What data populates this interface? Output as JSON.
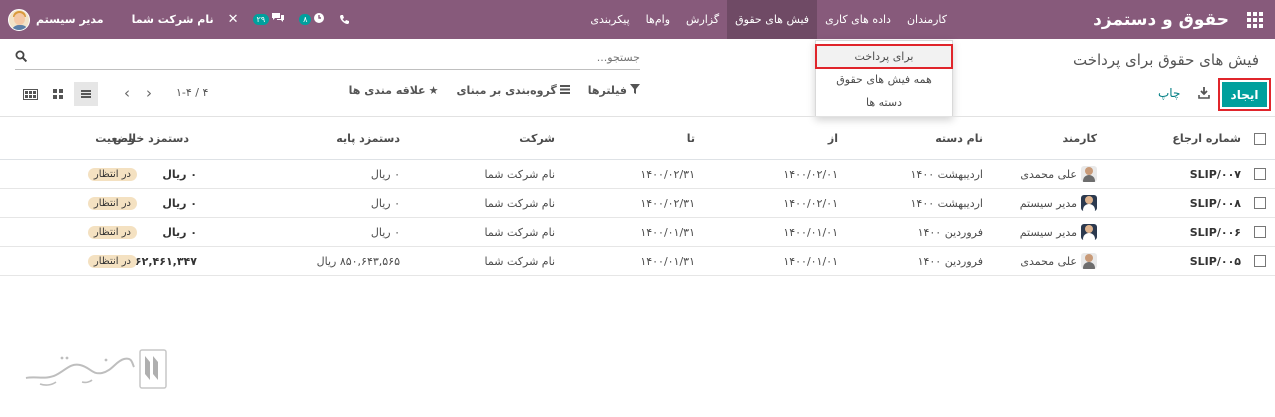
{
  "navbar": {
    "brand": "حقوق و دستمزد",
    "menu": [
      "کارمندان",
      "داده های کاری",
      "فیش های حقوق",
      "گزارش",
      "وام‌ها",
      "پیکربندی"
    ],
    "user_name": "مدیر سیستم",
    "company": "نام شرکت شما",
    "activity_badge": "۸",
    "chat_badge": "۲۹"
  },
  "dropdown": {
    "items": [
      "برای پرداخت",
      "همه فیش های حقوق",
      "دسته ها"
    ]
  },
  "control": {
    "title": "فیش های حقوق برای پرداخت",
    "search_placeholder": "جستجو...",
    "create_label": "ایجاد",
    "print_label": "چاپ",
    "filters_label": "فیلترها",
    "groupby_label": "گروه‌بندی بر مبنای",
    "favorites_label": "علاقه مندی ها",
    "pager": "۱-۴ / ۴"
  },
  "table": {
    "headers": {
      "ref": "شماره ارجاع",
      "employee": "کارمند",
      "batch": "نام دسته",
      "from": "از",
      "to": "تا",
      "company": "شرکت",
      "base": "دستمزد پایه",
      "net": "دستمزد خالص",
      "status": "وضعیت"
    },
    "rows": [
      {
        "ref": "SLIP/۰۰۷",
        "employee": "علی محمدی",
        "batch": "اردیبهشت ۱۴۰۰",
        "from": "۱۴۰۰/۰۲/۰۱",
        "to": "۱۴۰۰/۰۲/۳۱",
        "company": "نام شرکت شما",
        "base": "۰ ریال",
        "net": "۰ ریال",
        "status": "در انتظار"
      },
      {
        "ref": "SLIP/۰۰۸",
        "employee": "مدیر سیستم",
        "batch": "اردیبهشت ۱۴۰۰",
        "from": "۱۴۰۰/۰۲/۰۱",
        "to": "۱۴۰۰/۰۲/۳۱",
        "company": "نام شرکت شما",
        "base": "۰ ریال",
        "net": "۰ ریال",
        "status": "در انتظار"
      },
      {
        "ref": "SLIP/۰۰۶",
        "employee": "مدیر سیستم",
        "batch": "فروردین ۱۴۰۰",
        "from": "۱۴۰۰/۰۱/۰۱",
        "to": "۱۴۰۰/۰۱/۳۱",
        "company": "نام شرکت شما",
        "base": "۰ ریال",
        "net": "۰ ریال",
        "status": "در انتظار"
      },
      {
        "ref": "SLIP/۰۰۵",
        "employee": "علی محمدی",
        "batch": "فروردین ۱۴۰۰",
        "from": "۱۴۰۰/۰۱/۰۱",
        "to": "۱۴۰۰/۰۱/۳۱",
        "company": "نام شرکت شما",
        "base": "۸۵۰,۶۴۳,۵۶۵ ریال",
        "net": "۸۶۲,۴۶۱,۳۴۷ ریال",
        "status": "در انتظار"
      }
    ]
  },
  "watermark": {
    "text": "تسهیل‌گستر"
  },
  "colors": {
    "navbar": "#875a7b",
    "primary": "#00a09d",
    "highlight": "#e0252b",
    "status_pill": "#f4e1c1"
  }
}
